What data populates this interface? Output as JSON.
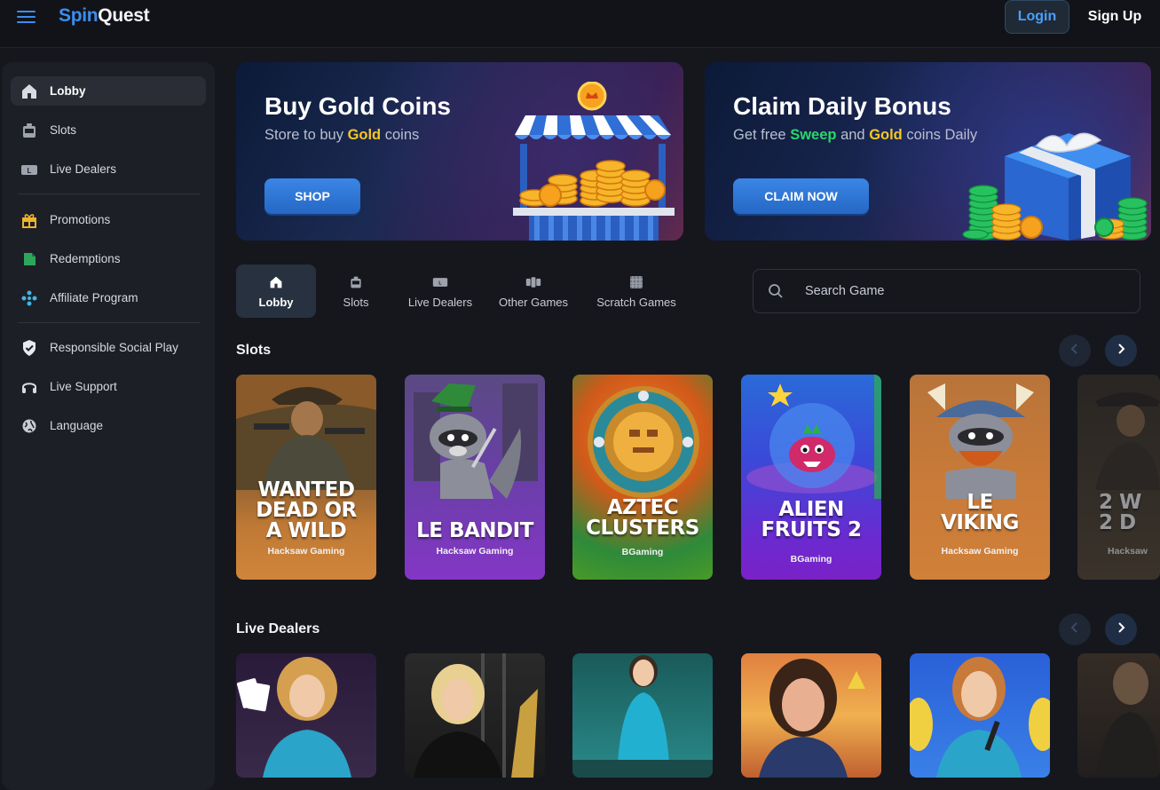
{
  "header": {
    "brand_part1": "Spin",
    "brand_part2": "Quest",
    "login_label": "Login",
    "signup_label": "Sign Up"
  },
  "sidebar": {
    "items": [
      {
        "label": "Lobby",
        "icon": "home-icon"
      },
      {
        "label": "Slots",
        "icon": "slot-machine-icon"
      },
      {
        "label": "Live Dealers",
        "icon": "card-icon"
      },
      {
        "label": "Promotions",
        "icon": "gift-icon"
      },
      {
        "label": "Redemptions",
        "icon": "ticket-icon"
      },
      {
        "label": "Affiliate Program",
        "icon": "network-icon"
      },
      {
        "label": "Responsible Social Play",
        "icon": "shield-icon"
      },
      {
        "label": "Live Support",
        "icon": "headset-icon"
      },
      {
        "label": "Language",
        "icon": "globe-icon"
      }
    ]
  },
  "banners": {
    "gold": {
      "title": "Buy Gold Coins",
      "sub_prefix": "Store to buy ",
      "sub_highlight": "Gold",
      "sub_suffix": " coins",
      "button": "SHOP"
    },
    "bonus": {
      "title": "Claim Daily Bonus",
      "sub_prefix": "Get free ",
      "sub_highlight1": "Sweep",
      "sub_mid": " and ",
      "sub_highlight2": "Gold",
      "sub_suffix": " coins Daily",
      "button": "CLAIM NOW"
    }
  },
  "tabs": [
    {
      "label": "Lobby",
      "icon": "home-icon"
    },
    {
      "label": "Slots",
      "icon": "slot-machine-icon"
    },
    {
      "label": "Live Dealers",
      "icon": "card-icon"
    },
    {
      "label": "Other Games",
      "icon": "dice-icon"
    },
    {
      "label": "Scratch Games",
      "icon": "scratch-card-icon"
    }
  ],
  "search": {
    "placeholder": "Search Game"
  },
  "sections": {
    "slots_title": "Slots",
    "live_title": "Live Dealers"
  },
  "slots": [
    {
      "title": "WANTED\nDEAD OR\nA WILD",
      "provider": "Hacksaw Gaming"
    },
    {
      "title": "LE BANDIT",
      "provider": "Hacksaw Gaming"
    },
    {
      "title": "AZTEC\nCLUSTERS",
      "provider": "BGaming"
    },
    {
      "title": "ALIEN\nFRUITS 2",
      "provider": "BGaming"
    },
    {
      "title": "LE\nVIKING",
      "provider": "Hacksaw Gaming"
    },
    {
      "title": "2 W\n2 D",
      "provider": "Hacksaw"
    }
  ],
  "colors": {
    "accent": "#3b8ef0",
    "gold": "#f7c722",
    "sweep": "#27d86a",
    "background": "#15171d",
    "sidebar": "#1d1f26"
  }
}
